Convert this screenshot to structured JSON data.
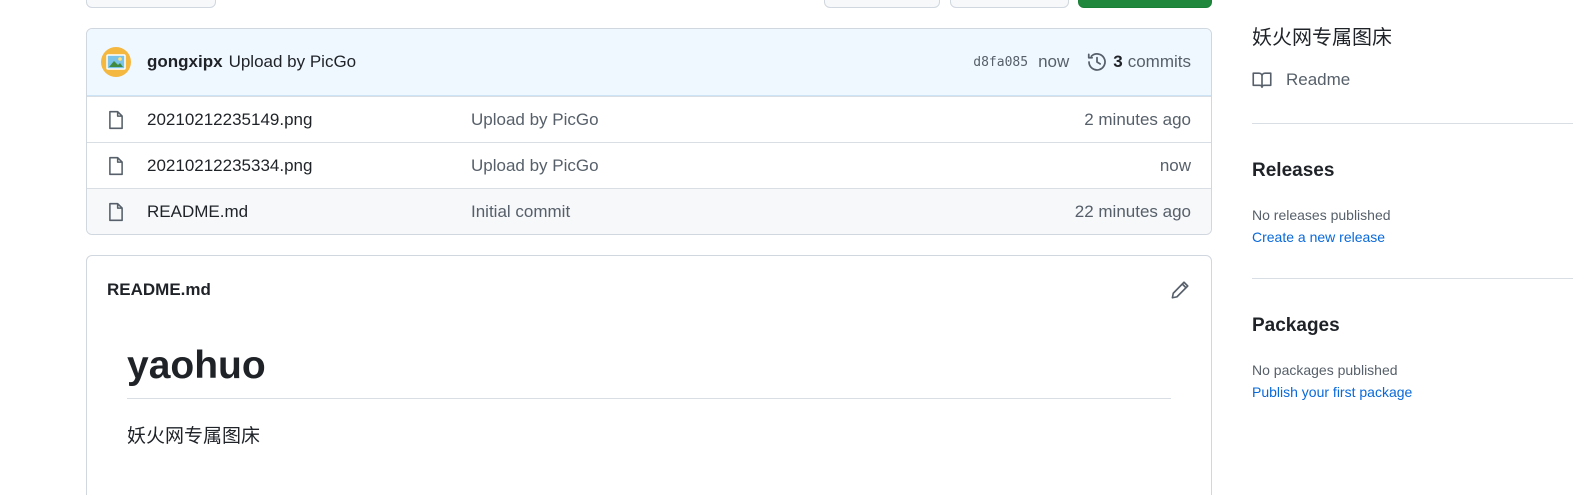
{
  "commit_bar": {
    "author": "gongxipx",
    "message": "Upload by PicGo",
    "sha": "d8fa085",
    "time": "now",
    "commit_count": "3",
    "commit_word": "commits"
  },
  "files": [
    {
      "name": "20210212235149.png",
      "commit": "Upload by PicGo",
      "age": "2 minutes ago"
    },
    {
      "name": "20210212235334.png",
      "commit": "Upload by PicGo",
      "age": "now"
    },
    {
      "name": "README.md",
      "commit": "Initial commit",
      "age": "22 minutes ago"
    }
  ],
  "readme": {
    "filename": "README.md",
    "heading": "yaohuo",
    "paragraph": "妖火网专属图床"
  },
  "sidebar": {
    "description": "妖火网专属图床",
    "readme_label": "Readme",
    "releases": {
      "heading": "Releases",
      "empty": "No releases published",
      "link": "Create a new release"
    },
    "packages": {
      "heading": "Packages",
      "empty": "No packages published",
      "link": "Publish your first package"
    }
  },
  "colors": {
    "accent_link": "#0969da",
    "green_button": "#1f883d",
    "commit_bar_bg": "#f0f8ff"
  },
  "icons": [
    "avatar-image-icon",
    "history-icon",
    "file-icon",
    "pencil-icon",
    "book-icon"
  ]
}
